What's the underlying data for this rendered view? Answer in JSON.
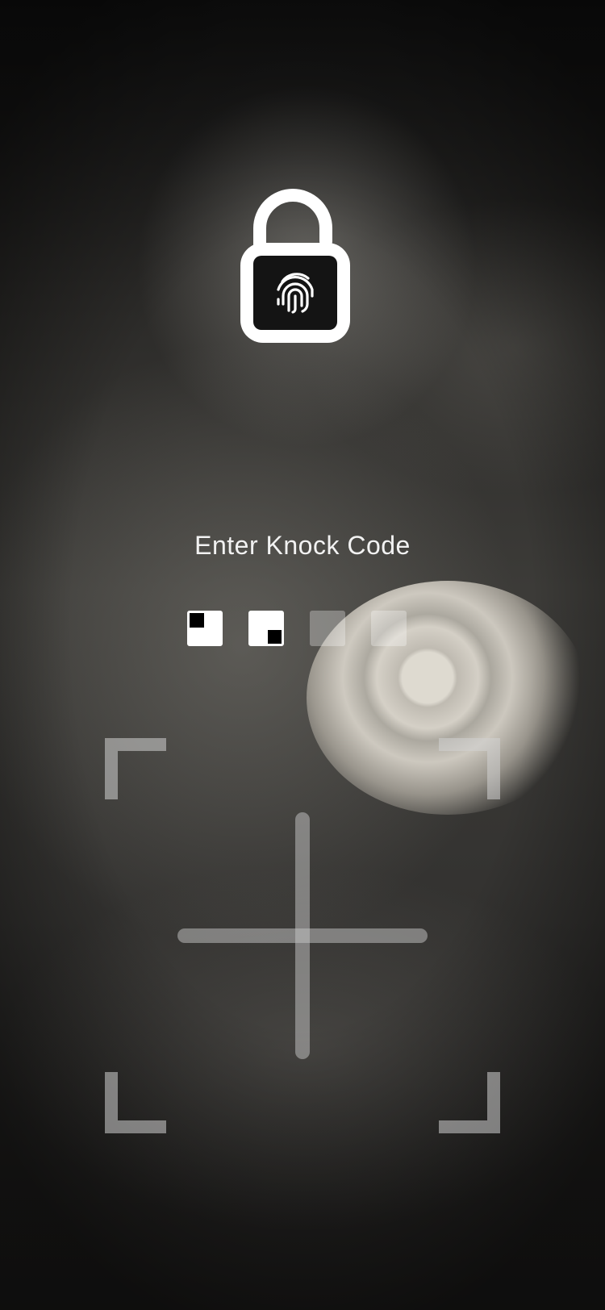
{
  "lockscreen": {
    "prompt": "Enter Knock Code",
    "lock_icon": "fingerprint-padlock-icon",
    "entered_taps": [
      {
        "filled_quadrant": "top-left",
        "state": "entered"
      },
      {
        "filled_quadrant": "bottom-right",
        "state": "entered"
      },
      {
        "filled_quadrant": "",
        "state": "empty"
      },
      {
        "filled_quadrant": "",
        "state": "empty"
      }
    ],
    "pad": {
      "quadrants": [
        "top-left",
        "top-right",
        "bottom-left",
        "bottom-right"
      ],
      "divider_icon": "cross-divider-icon"
    },
    "colors": {
      "text": "#f2f2f2",
      "indicator_active": "#ffffff",
      "indicator_filled": "#000000",
      "pad_guides": "#c8c8c8"
    }
  }
}
